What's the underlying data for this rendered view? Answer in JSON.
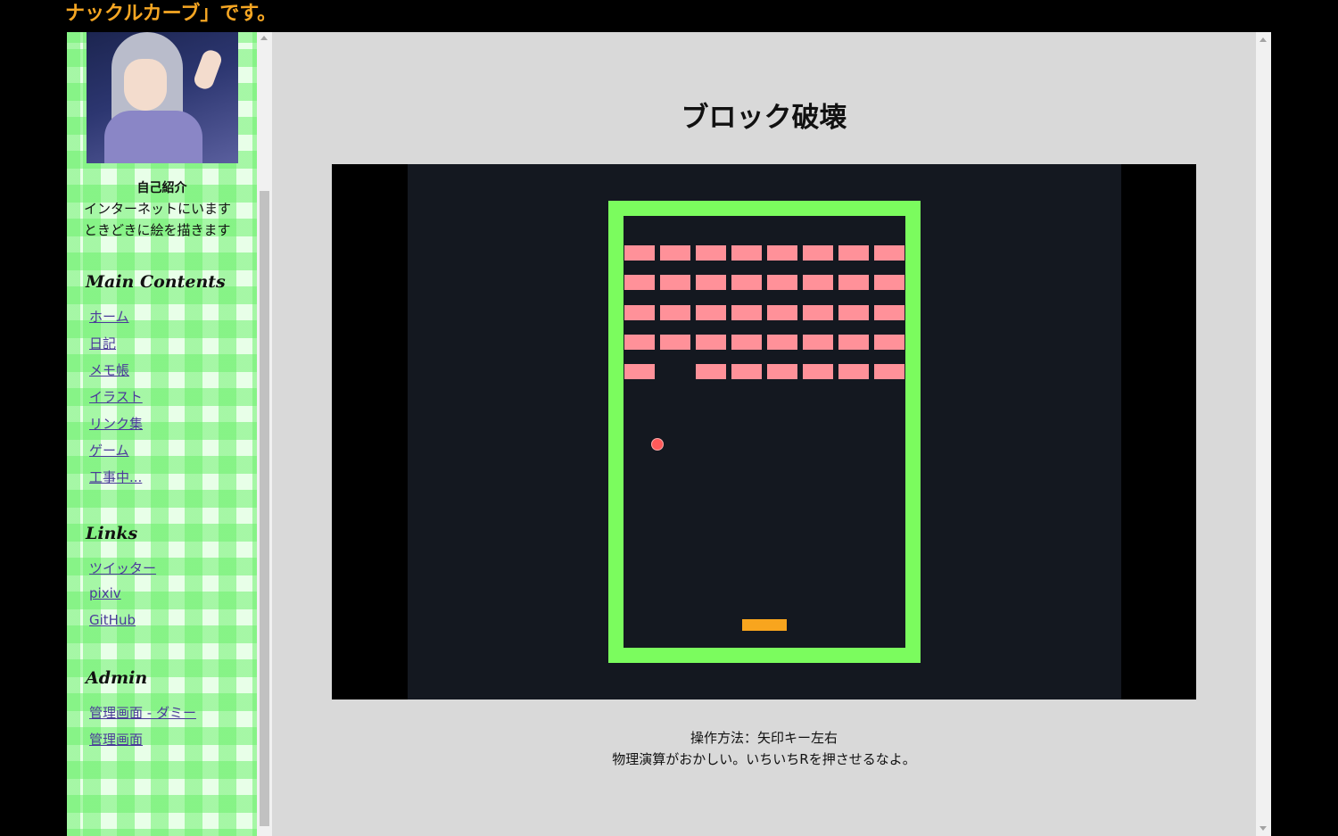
{
  "header": {
    "title_fragment": "ナックルカーブ」です。"
  },
  "sidebar": {
    "intro": {
      "title": "自己紹介",
      "lines": [
        "インターネットにいます",
        "ときどきに絵を描きます"
      ]
    },
    "sections": {
      "main_contents": {
        "heading": "Main Contents",
        "items": [
          "ホーム",
          "日記",
          "メモ帳",
          "イラスト",
          "リンク集",
          "ゲーム",
          "工事中..."
        ]
      },
      "links": {
        "heading": "Links",
        "items": [
          "ツイッター",
          "pixiv",
          "GitHub"
        ]
      },
      "admin": {
        "heading": "Admin",
        "items": [
          "管理画面 - ダミー",
          "管理画面"
        ]
      }
    }
  },
  "main": {
    "title": "ブロック破壊",
    "instructions": [
      "操作方法：矢印キー左右",
      "物理演算がおかしい。いちいちRを押させるなよ。"
    ]
  },
  "game": {
    "colors": {
      "wall": "#7bfc5e",
      "brick": "#ff9199",
      "ball": "#ff5a5a",
      "paddle": "#f8a51e",
      "background": "#141820"
    },
    "brick_rows": [
      [
        1,
        1,
        1,
        1,
        1,
        1,
        1,
        1
      ],
      [
        1,
        1,
        1,
        1,
        1,
        1,
        1,
        1
      ],
      [
        1,
        1,
        1,
        1,
        1,
        1,
        1,
        1
      ],
      [
        1,
        1,
        1,
        1,
        1,
        1,
        1,
        1
      ],
      [
        1,
        0,
        1,
        1,
        1,
        1,
        1,
        1
      ]
    ]
  }
}
